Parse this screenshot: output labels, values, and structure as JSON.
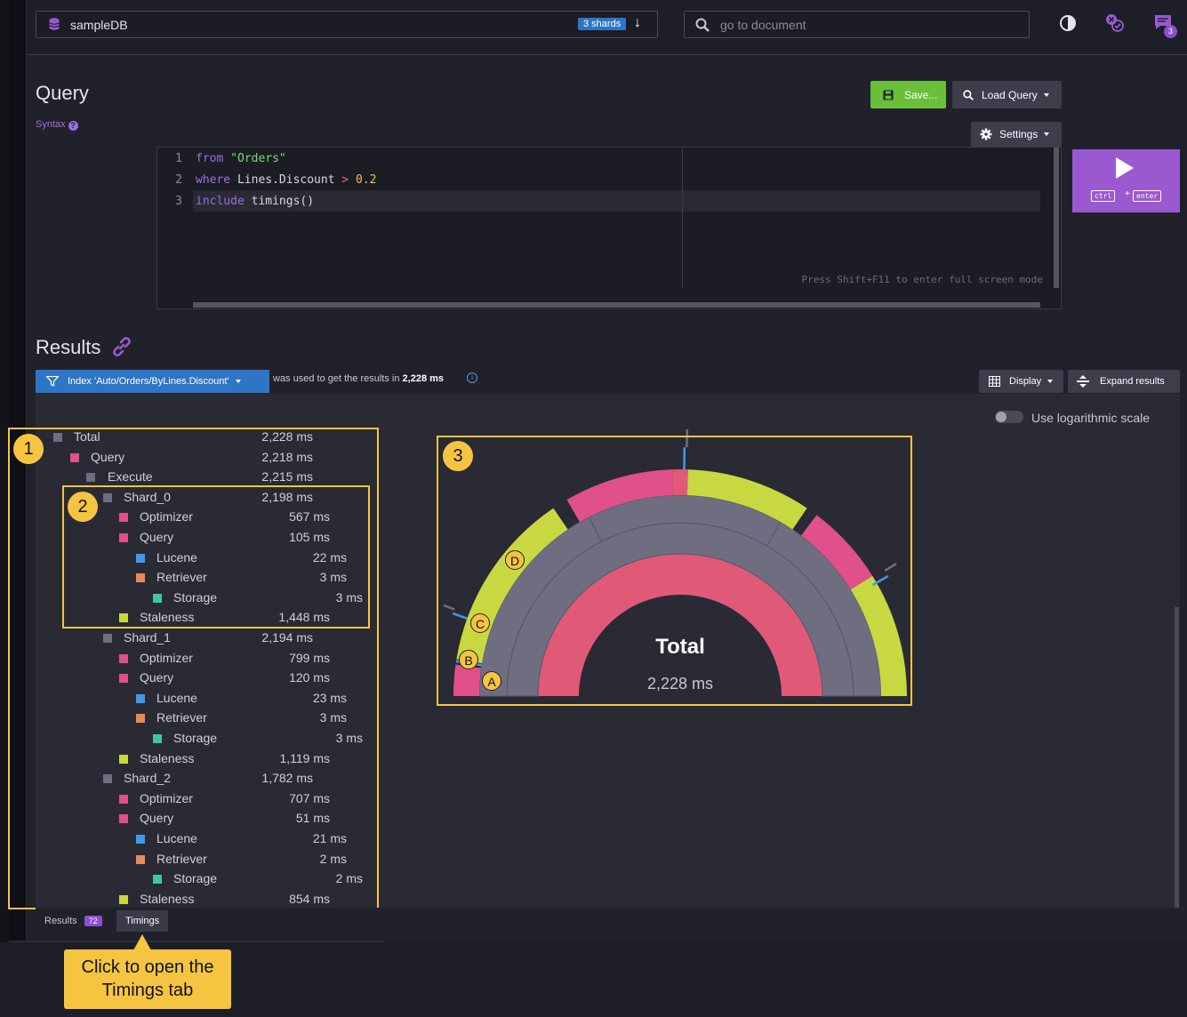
{
  "topbar": {
    "database": "sampleDB",
    "shards_badge": "3 shards",
    "search_placeholder": "go to document",
    "notification_count": "3"
  },
  "query": {
    "title": "Query",
    "syntax_label": "Syntax",
    "save_label": "Save...",
    "load_label": "Load Query",
    "settings_label": "Settings",
    "editor_hint": "Press Shift+F11 to enter full screen mode",
    "line_numbers": [
      "1",
      "2",
      "3"
    ],
    "run_keys": [
      "ctrl",
      "+",
      "enter"
    ]
  },
  "results": {
    "title": "Results",
    "index_label": "Index 'Auto/Orders/ByLines.Discount'",
    "used_text": "was used to get the results in",
    "used_time": "2,228 ms",
    "display_label": "Display",
    "expand_label": "Expand results",
    "log_scale_label": "Use logarithmic scale",
    "log_scale_on": false
  },
  "timings_tree": [
    {
      "label": "Total",
      "value": "2,228 ms",
      "color": "#6e6e80"
    },
    {
      "label": "Query",
      "value": "2,218 ms",
      "color": "#e0508a"
    },
    {
      "label": "Execute",
      "value": "2,215 ms",
      "color": "#6e6e80"
    },
    {
      "label": "Shard_0",
      "value": "2,198 ms",
      "color": "#6e6e80"
    },
    {
      "label": "Optimizer",
      "value": "567 ms",
      "color": "#e0508a"
    },
    {
      "label": "Query",
      "value": "105 ms",
      "color": "#e0508a"
    },
    {
      "label": "Lucene",
      "value": "22 ms",
      "color": "#3f9ae8"
    },
    {
      "label": "Retriever",
      "value": "3 ms",
      "color": "#e88a5a"
    },
    {
      "label": "Storage",
      "value": "3 ms",
      "color": "#3fc8a0"
    },
    {
      "label": "Staleness",
      "value": "1,448 ms",
      "color": "#c8d840"
    },
    {
      "label": "Shard_1",
      "value": "2,194 ms",
      "color": "#6e6e80"
    },
    {
      "label": "Optimizer",
      "value": "799 ms",
      "color": "#e0508a"
    },
    {
      "label": "Query",
      "value": "120 ms",
      "color": "#e0508a"
    },
    {
      "label": "Lucene",
      "value": "23 ms",
      "color": "#3f9ae8"
    },
    {
      "label": "Retriever",
      "value": "3 ms",
      "color": "#e88a5a"
    },
    {
      "label": "Storage",
      "value": "3 ms",
      "color": "#3fc8a0"
    },
    {
      "label": "Staleness",
      "value": "1,119 ms",
      "color": "#c8d840"
    },
    {
      "label": "Shard_2",
      "value": "1,782 ms",
      "color": "#6e6e80"
    },
    {
      "label": "Optimizer",
      "value": "707 ms",
      "color": "#e0508a"
    },
    {
      "label": "Query",
      "value": "51 ms",
      "color": "#e0508a"
    },
    {
      "label": "Lucene",
      "value": "21 ms",
      "color": "#3f9ae8"
    },
    {
      "label": "Retriever",
      "value": "2 ms",
      "color": "#e88a5a"
    },
    {
      "label": "Storage",
      "value": "2 ms",
      "color": "#3fc8a0"
    },
    {
      "label": "Staleness",
      "value": "854 ms",
      "color": "#c8d840"
    }
  ],
  "chart": {
    "center_label": "Total",
    "center_value": "2,228 ms",
    "markers": [
      "A",
      "B",
      "C",
      "D"
    ]
  },
  "annotations": {
    "box1": "1",
    "box2": "2",
    "box3": "3",
    "callout": "Click to open the Timings tab"
  },
  "tabs": {
    "results_label": "Results",
    "results_count": "72",
    "timings_label": "Timings"
  },
  "colors": {
    "accent_purple": "#9b59cf",
    "primary_blue": "#2f75c6",
    "save_green": "#6abf3a",
    "highlight_yellow": "#f5c542"
  }
}
